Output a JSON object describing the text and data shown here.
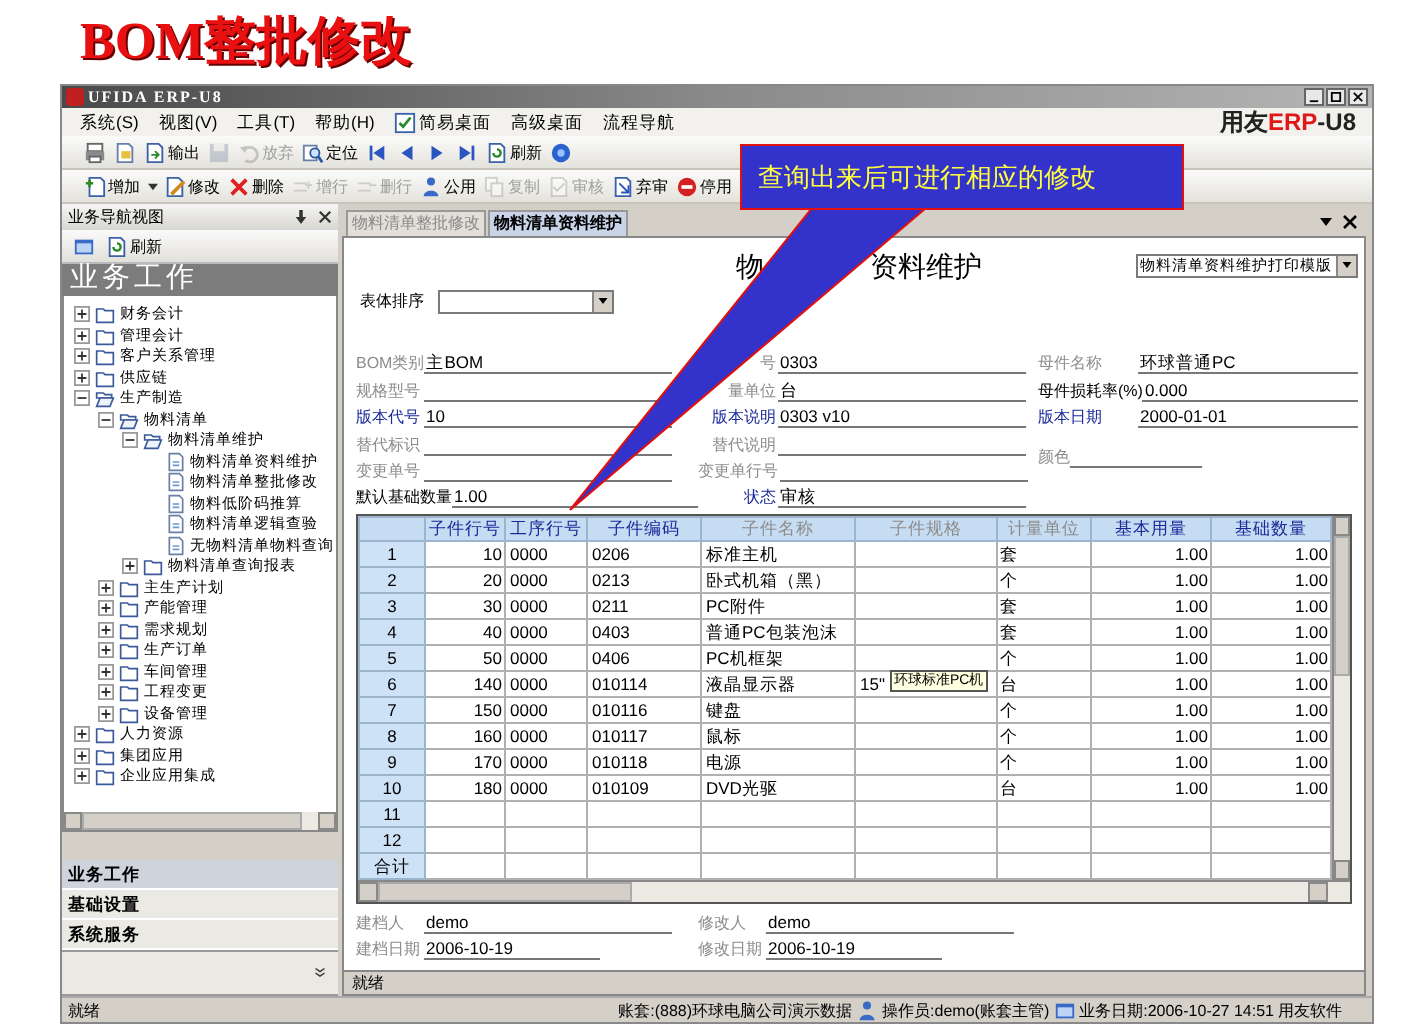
{
  "slide_title": "BOM整批修改",
  "window": {
    "title": "UFIDA ERP-U8"
  },
  "menu": [
    {
      "label": "系统(S)"
    },
    {
      "label": "视图(V)"
    },
    {
      "label": "工具(T)"
    },
    {
      "label": "帮助(H)"
    },
    {
      "label": "简易桌面",
      "kind": "icon"
    },
    {
      "label": "高级桌面"
    },
    {
      "label": "流程导航"
    }
  ],
  "brand": {
    "vendor": "用友",
    "product": "ERP",
    "edition": "-U8"
  },
  "toolbar_1": [
    {
      "disabled": false
    },
    {
      "disabled": false
    },
    {
      "label": "输出",
      "disabled": false
    },
    {
      "disabled": true
    },
    {
      "label": "放弃",
      "disabled": true
    },
    {
      "label": "定位",
      "disabled": false
    },
    {
      "disabled": false
    },
    {
      "disabled": false
    },
    {
      "disabled": false
    },
    {
      "disabled": false
    },
    {
      "label": "刷新",
      "disabled": false
    },
    {
      "disabled": false
    }
  ],
  "toolbar_2": [
    {
      "label": "增加",
      "disabled": false
    },
    {
      "label": "修改",
      "disabled": false
    },
    {
      "label": "删除",
      "disabled": false
    },
    {
      "label": "增行",
      "disabled": true
    },
    {
      "label": "删行",
      "disabled": true
    },
    {
      "label": "公用",
      "disabled": false
    },
    {
      "label": "复制",
      "disabled": true
    },
    {
      "label": "审核",
      "disabled": true
    },
    {
      "label": "弃审",
      "disabled": false
    },
    {
      "label": "停用",
      "disabled": false
    }
  ],
  "nav_panel": {
    "title": "业务导航视图",
    "refresh": "刷新",
    "section": "业务工作",
    "tree": [
      {
        "label": "财务会计",
        "kind": "folder",
        "expanded": false
      },
      {
        "label": "管理会计",
        "kind": "folder",
        "expanded": false
      },
      {
        "label": "客户关系管理",
        "kind": "folder",
        "expanded": false
      },
      {
        "label": "供应链",
        "kind": "folder",
        "expanded": false
      },
      {
        "label": "生产制造",
        "kind": "folder",
        "expanded": true,
        "children": [
          {
            "label": "物料清单",
            "kind": "folder",
            "expanded": true,
            "children": [
              {
                "label": "物料清单维护",
                "kind": "folder",
                "expanded": true,
                "children": [
                  {
                    "label": "物料清单资料维护",
                    "kind": "page"
                  },
                  {
                    "label": "物料清单整批修改",
                    "kind": "page"
                  },
                  {
                    "label": "物料低阶码推算",
                    "kind": "page"
                  },
                  {
                    "label": "物料清单逻辑查验",
                    "kind": "page"
                  },
                  {
                    "label": "无物料清单物料查询",
                    "kind": "page"
                  }
                ]
              },
              {
                "label": "物料清单查询报表",
                "kind": "folder",
                "expanded": false
              }
            ]
          },
          {
            "label": "主生产计划",
            "kind": "folder",
            "expanded": false
          },
          {
            "label": "产能管理",
            "kind": "folder",
            "expanded": false
          },
          {
            "label": "需求规划",
            "kind": "folder",
            "expanded": false
          },
          {
            "label": "生产订单",
            "kind": "folder",
            "expanded": false
          },
          {
            "label": "车间管理",
            "kind": "folder",
            "expanded": false
          },
          {
            "label": "工程变更",
            "kind": "folder",
            "expanded": false
          },
          {
            "label": "设备管理",
            "kind": "folder",
            "expanded": false
          }
        ]
      },
      {
        "label": "人力资源",
        "kind": "folder",
        "expanded": false
      },
      {
        "label": "集团应用",
        "kind": "folder",
        "expanded": false
      },
      {
        "label": "企业应用集成",
        "kind": "folder",
        "expanded": false
      }
    ],
    "modules": [
      {
        "label": "业务工作",
        "selected": true
      },
      {
        "label": "基础设置",
        "selected": false
      },
      {
        "label": "系统服务",
        "selected": false
      }
    ]
  },
  "tabs": [
    {
      "label": "物料清单整批修改",
      "selected": false
    },
    {
      "label": "物料清单资料维护",
      "selected": true
    }
  ],
  "form": {
    "title_parts": [
      "物",
      "资料维护"
    ],
    "print_template": "物料清单资料维护打印模版",
    "sort_label": "表体排序",
    "field_columns": [
      [
        {
          "label": "BOM类别",
          "value": "主BOM",
          "kind": "optional"
        },
        {
          "label": "规格型号",
          "kind": "optional"
        },
        {
          "label": "版本代号",
          "value": "10",
          "kind": "required"
        },
        {
          "label": "替代标识",
          "kind": "optional"
        },
        {
          "label": "变更单号",
          "kind": "optional"
        },
        {
          "label": "默认基础数量",
          "value": "1.00",
          "kind": "normal"
        }
      ],
      [
        {
          "label": "号",
          "value": "0303",
          "kind": "optional"
        },
        {
          "label": "量单位",
          "value": "台",
          "kind": "optional"
        },
        {
          "label": "版本说明",
          "value": "0303 v10",
          "kind": "required"
        },
        {
          "label": "替代说明",
          "kind": "optional"
        },
        {
          "label": "变更单行号",
          "kind": "optional"
        },
        {
          "label": "状态",
          "value": "审核",
          "kind": "required"
        }
      ],
      [
        {
          "label": "母件名称",
          "value": "环球普通PC",
          "kind": "optional"
        },
        {
          "label": "母件损耗率(%)",
          "value": "0.000",
          "kind": "normal"
        },
        {
          "label": "版本日期",
          "value": "2000-01-01",
          "kind": "required"
        },
        {
          "label": "颜色",
          "kind": "optional"
        }
      ]
    ]
  },
  "table": {
    "columns": [
      {
        "label": "子件行号",
        "kind": "required"
      },
      {
        "label": "工序行号",
        "kind": "required"
      },
      {
        "label": "子件编码",
        "kind": "required"
      },
      {
        "label": "子件名称",
        "kind": "optional"
      },
      {
        "label": "子件规格",
        "kind": "optional"
      },
      {
        "label": "计量单位",
        "kind": "optional"
      },
      {
        "label": "基本用量",
        "kind": "required"
      },
      {
        "label": "基础数量",
        "kind": "required"
      }
    ],
    "rows": [
      {
        "num": "1",
        "cells": [
          "10",
          "0000",
          "0206",
          "标准主机",
          "",
          "套",
          "1.00",
          "1.00"
        ]
      },
      {
        "num": "2",
        "cells": [
          "20",
          "0000",
          "0213",
          "卧式机箱（黑）",
          "",
          "个",
          "1.00",
          "1.00"
        ]
      },
      {
        "num": "3",
        "cells": [
          "30",
          "0000",
          "0211",
          "PC附件",
          "",
          "套",
          "1.00",
          "1.00"
        ]
      },
      {
        "num": "4",
        "cells": [
          "40",
          "0000",
          "0403",
          "普通PC包装泡沫",
          "",
          "套",
          "1.00",
          "1.00"
        ]
      },
      {
        "num": "5",
        "cells": [
          "50",
          "0000",
          "0406",
          "PC机框架",
          "",
          "个",
          "1.00",
          "1.00"
        ]
      },
      {
        "num": "6",
        "cells": [
          "140",
          "0000",
          "010114",
          "液晶显示器",
          "15\"",
          "台",
          "1.00",
          "1.00"
        ]
      },
      {
        "num": "7",
        "cells": [
          "150",
          "0000",
          "010116",
          "键盘",
          "",
          "个",
          "1.00",
          "1.00"
        ]
      },
      {
        "num": "8",
        "cells": [
          "160",
          "0000",
          "010117",
          "鼠标",
          "",
          "个",
          "1.00",
          "1.00"
        ]
      },
      {
        "num": "9",
        "cells": [
          "170",
          "0000",
          "010118",
          "电源",
          "",
          "个",
          "1.00",
          "1.00"
        ]
      },
      {
        "num": "10",
        "cells": [
          "180",
          "0000",
          "010109",
          "DVD光驱",
          "",
          "台",
          "1.00",
          "1.00"
        ]
      },
      {
        "num": "11"
      },
      {
        "num": "12"
      }
    ],
    "footer": "合计",
    "tooltip": "环球标准PC机"
  },
  "audit": [
    {
      "label": "建档人",
      "value": "demo"
    },
    {
      "label": "修改人",
      "value": "demo"
    },
    {
      "label": "建档日期",
      "value": "2006-10-19"
    },
    {
      "label": "修改日期",
      "value": "2006-10-19"
    }
  ],
  "panel_status": "就绪",
  "status_bar": {
    "left": "就绪",
    "account": "账套:(888)环球电脑公司演示数据",
    "operator": "操作员:demo(账套主管)",
    "date": "业务日期:2006-10-27 14:51",
    "vendor": "用友软件"
  },
  "callout": "查询出来后可进行相应的修改"
}
